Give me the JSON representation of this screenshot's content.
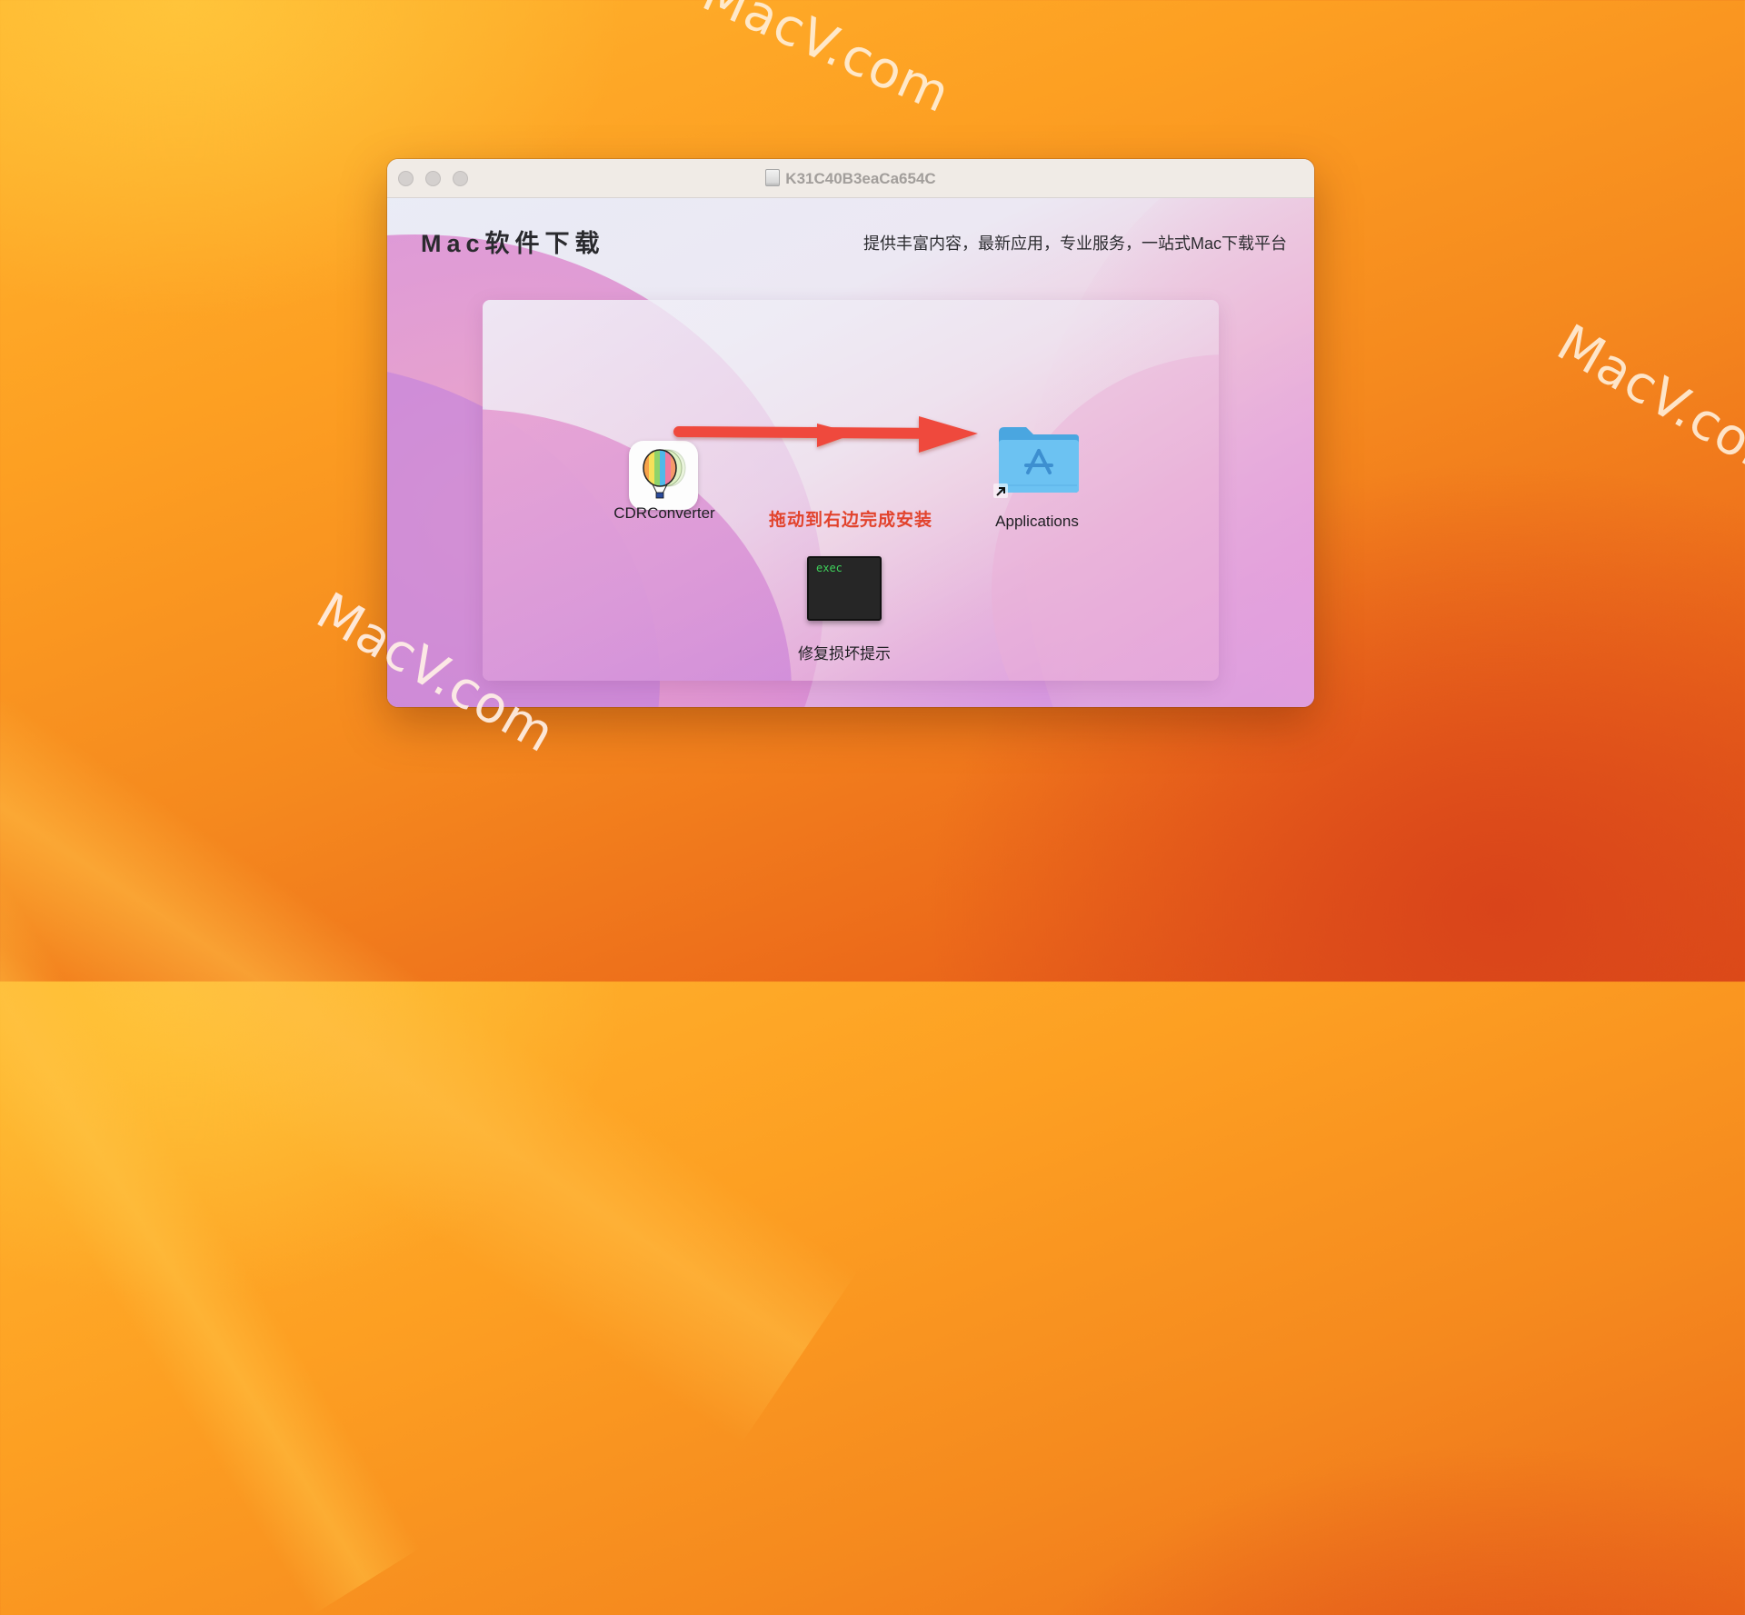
{
  "desktop": {
    "watermarks": [
      "MacV.com",
      "MacV.com",
      "MacV.com"
    ]
  },
  "window": {
    "title": "K31C40B3eaCa654C",
    "title_icon": "disk-icon",
    "traffic_lights": [
      "close",
      "minimize",
      "zoom"
    ]
  },
  "header": {
    "brand": "Mac软件下载",
    "slogan": "提供丰富内容，最新应用，专业服务，一站式Mac下载平台"
  },
  "installer": {
    "app": {
      "label": "CDRConverter",
      "icon": "hot-air-balloon-icon"
    },
    "instruction": "拖动到右边完成安装",
    "target": {
      "label": "Applications",
      "icon": "applications-folder-icon"
    },
    "fix": {
      "label": "修复损坏提示",
      "icon_text": "exec"
    }
  },
  "colors": {
    "arrow": "#ef4a3c",
    "instruction_text": "#e2432c",
    "folder": "#6cc2f2",
    "exec_text": "#3ed05a"
  }
}
